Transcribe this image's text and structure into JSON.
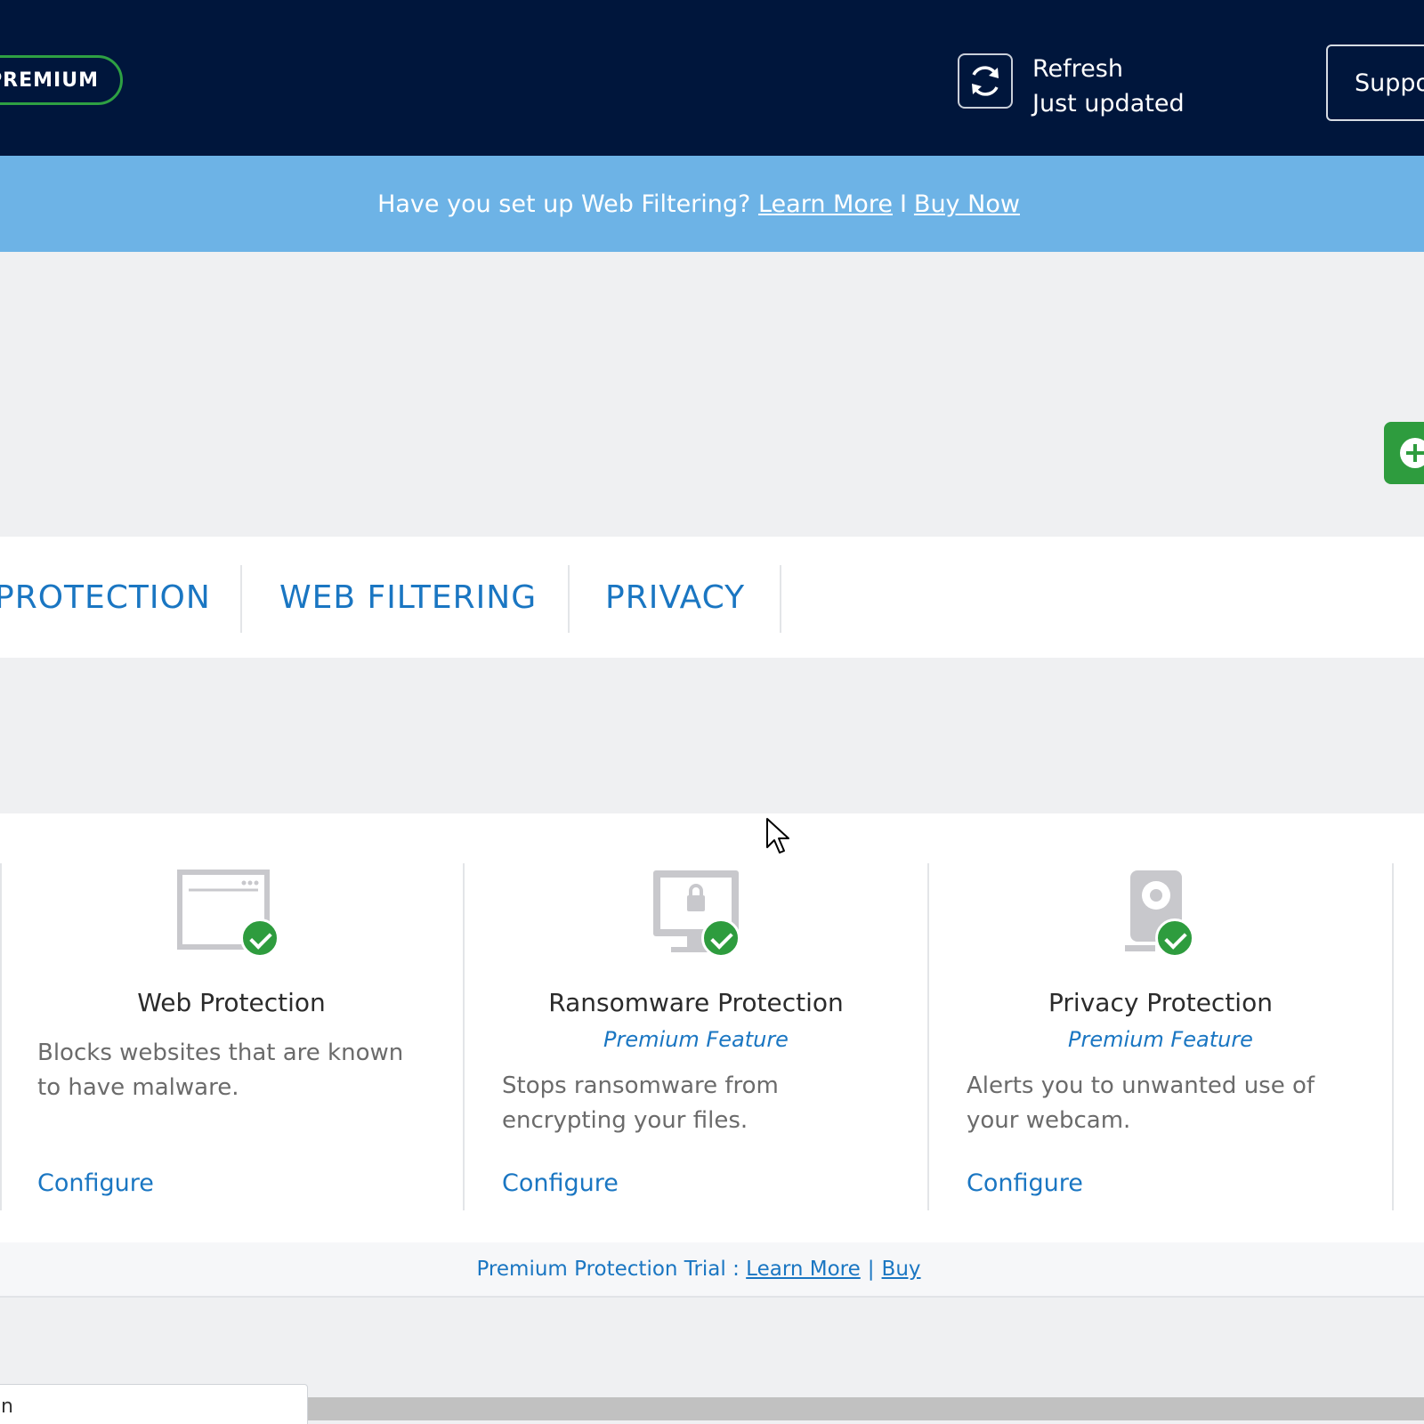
{
  "header": {
    "badge": "PREMIUM",
    "refresh": {
      "title": "Refresh",
      "status": "Just updated"
    },
    "support_label": "Support"
  },
  "banner": {
    "question": "Have you set up Web Filtering?",
    "learn_more": "Learn More",
    "separator": "I",
    "buy_now": "Buy Now"
  },
  "tabs": [
    {
      "label": "PROTECTION"
    },
    {
      "label": "WEB FILTERING"
    },
    {
      "label": "PRIVACY"
    }
  ],
  "cards": [
    {
      "icon": "browser-window-icon",
      "title": "Web Protection",
      "premium": "",
      "description": "Blocks websites that are known to have malware.",
      "action": "Configure"
    },
    {
      "icon": "monitor-lock-icon",
      "title": "Ransomware Protection",
      "premium": "Premium Feature",
      "description": "Stops ransomware from encrypting your files.",
      "action": "Configure"
    },
    {
      "icon": "webcam-icon",
      "title": "Privacy Protection",
      "premium": "Premium Feature",
      "description": "Alerts you to unwanted use of your webcam.",
      "action": "Configure"
    }
  ],
  "trial": {
    "text": "Premium Protection Trial :",
    "learn_more": "Learn More",
    "separator": "|",
    "buy": "Buy"
  },
  "status_tooltip": "n",
  "colors": {
    "header_bg": "#00163c",
    "banner_bg": "#6db3e6",
    "accent_blue": "#1a76c2",
    "success_green": "#2e9c3e"
  }
}
